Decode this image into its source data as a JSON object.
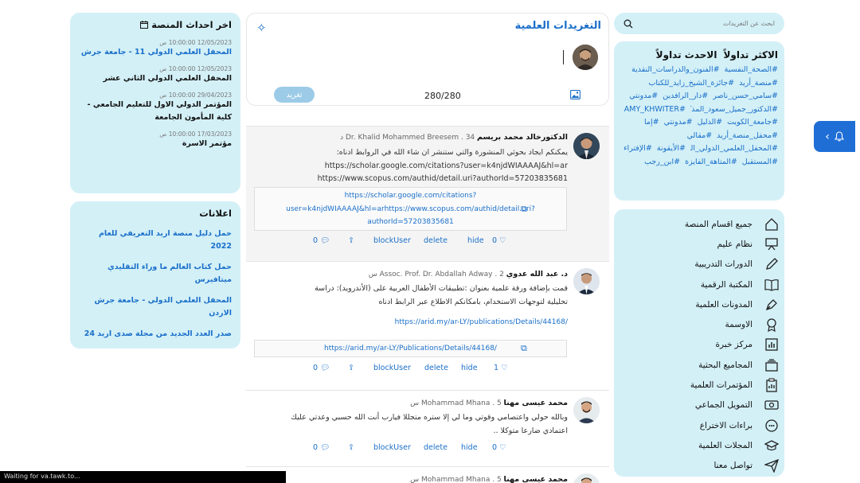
{
  "search": {
    "placeholder": "ابحث عن التغريدات"
  },
  "trending": {
    "tabs": [
      "الاكثر تداولاً",
      "الاحدث تداولاً"
    ],
    "hashtags": [
      "#الصحة_النفسية",
      "#الفنون_والدراسات_النقدية",
      "#منصة_أريد",
      "#جائزة_الشيخ_زايد_للكتاب",
      "#سامي_حسن_ناصر",
      "#دار_الرافدين",
      "#مدونتي",
      "#الدكتور_جميل_سعود_المذكور",
      "#AMY_KHWITER",
      "#جامعة_الكويت",
      "#الدليل",
      "#مدونتي",
      "#إما",
      "#محفل_منصة_أريد",
      "#مقالي",
      "#المحفل_العلمي_الدولي_الثاني",
      "#الأيقونة",
      "#الإفتراء",
      "#المستقبل",
      "#المتاهة_الفايزة",
      "#ابن_رجب"
    ]
  },
  "menu": [
    {
      "icon": "home-icon",
      "label": "جميع اقسام المنصة"
    },
    {
      "icon": "presentation-icon",
      "label": "نظام عليم"
    },
    {
      "icon": "pencil-icon",
      "label": "الدورات التدريبية"
    },
    {
      "icon": "book-icon",
      "label": "المكتبة الرقمية"
    },
    {
      "icon": "pen-nib-icon",
      "label": "المدونات العلمية"
    },
    {
      "icon": "badge-icon",
      "label": "الاوسمة"
    },
    {
      "icon": "chart-icon",
      "label": "مركز خبرة"
    },
    {
      "icon": "layers-icon",
      "label": "المجاميع البحثية"
    },
    {
      "icon": "clipboard-icon",
      "label": "المؤتمرات العلمية"
    },
    {
      "icon": "money-icon",
      "label": "التمويل الجماعي"
    },
    {
      "icon": "idea-icon",
      "label": "براءات الاختراع"
    },
    {
      "icon": "graduation-cap-icon",
      "label": "المجلات العلمية"
    },
    {
      "icon": "send-icon",
      "label": "تواصل معنا"
    }
  ],
  "composer": {
    "title": "التغريدات العلمية",
    "counter": "280/280",
    "post_label": "تغريد"
  },
  "actions": {
    "block": "blockUser",
    "delete": "delete",
    "hide": "hide"
  },
  "posts": [
    {
      "author": "الدكتورخالد محمد بريسم",
      "author_latin": "Dr. Khalid Mohammed Breesem",
      "time": "34 د",
      "body_lines": [
        "يمكنكم ايجاد بحوثي المنشورة والتي ستنشر ان شاء الله في الروابط ادناه:",
        "https://scholar.google.com/citations?user=k4njdWIAAAAJ&hl=ar",
        "https://www.scopus.com/authid/detail.uri?authorId=57203835681"
      ],
      "preview_lines": [
        "https://scholar.google.com/citations?",
        "user=k4njdWIAAAAJ&hl=arhttps://www.scopus.com/authid/detail.uri?",
        "authorId=57203835681"
      ],
      "likes": "0",
      "comments": "0"
    },
    {
      "author": "د. عبد الله عدوي",
      "author_latin": "Assoc. Prof. Dr. Abdallah Adway",
      "time": "2 س",
      "body_lines": [
        "قمت بإضافة ورقة علمية بعنوان :تطبيقات الأطفال العربية على (الأندرويد): دراسة",
        "تحليلية لتوجهات الاستخدام، بامكانكم الاطلاع عبر الرابط ادناه"
      ],
      "link": "https://arid.my/ar-LY/publications/Details/44168/",
      "preview_lines": [
        "https://arid.my/ar-LY/Publications/Details/44168/"
      ],
      "likes": "1",
      "comments": "0"
    },
    {
      "author": "محمد عيسى مهنا",
      "author_latin": "Mohammad Mhana",
      "time": "5 س",
      "body_lines": [
        "وبالله حولي واعتصامي وقوتي وما لي إلا ستره متجللا فيارب أنت الله حسبي وعدتي عليك",
        "اعتمادي ضارعا متوكلا .."
      ],
      "likes": "0",
      "comments": "0"
    },
    {
      "author": "محمد عيسى مهنا",
      "author_latin": "Mohammad Mhana",
      "time": "5 س"
    }
  ],
  "events": {
    "title": "اخر احداث المنصة",
    "items": [
      {
        "date": "12/05/2023 10:00:00 ص",
        "title": "المحفل العلمي الدولي 11 - جامعة جرش",
        "link": true
      },
      {
        "date": "12/05/2023 10:00:00 ص",
        "title": "المحفل العلمي الدولي الثاني عشر",
        "link": false
      },
      {
        "date": "29/04/2023 10:00:00 ص",
        "title": "المؤتمر الدولي الاول للتعليم الجامعي - كلية المأمون الجامعة",
        "link": false
      },
      {
        "date": "17/03/2023 10:00:00 ص",
        "title": "مؤتمر الاسرة",
        "link": false
      }
    ]
  },
  "ads": {
    "title": "اعلانات",
    "items": [
      "حمل دليل منصة اريد التعريفي للعام 2022",
      "حمل كتاب العالم ما وراء التقليدي ميتافيرس",
      "المحفل العلمي الدولي - جامعة جرش الاردن",
      "صدر العدد الجديد من مجلة صدى اريد 24"
    ]
  },
  "status_bar": "Waiting for va.tawk.to...",
  "colors": {
    "accent": "#1a6fc9",
    "panel": "#d3f0f7",
    "bell": "#1f6ed6"
  }
}
